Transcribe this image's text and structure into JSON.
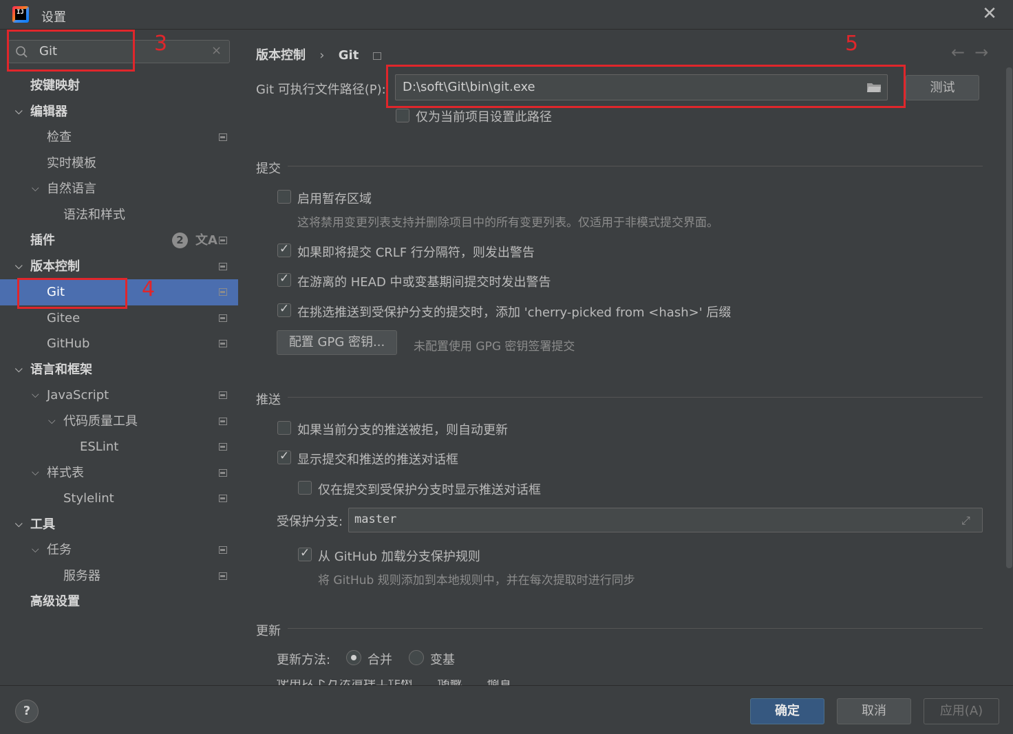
{
  "window": {
    "title": "设置",
    "close_icon": "close-icon"
  },
  "search": {
    "value": "Git",
    "clear": "×"
  },
  "sidebar": {
    "badge": "2",
    "items": [
      {
        "label": "按键映射"
      },
      {
        "label": "编辑器",
        "chevron": "v"
      },
      {
        "label": "检查"
      },
      {
        "label": "实时模板"
      },
      {
        "label": "自然语言",
        "chevron": "v"
      },
      {
        "label": "语法和样式"
      },
      {
        "label": "插件"
      },
      {
        "label": "版本控制",
        "chevron": "v"
      },
      {
        "label": "Git"
      },
      {
        "label": "Gitee"
      },
      {
        "label": "GitHub"
      },
      {
        "label": "语言和框架",
        "chevron": "v"
      },
      {
        "label": "JavaScript",
        "chevron": "v"
      },
      {
        "label": "代码质量工具",
        "chevron": "v"
      },
      {
        "label": "ESLint"
      },
      {
        "label": "样式表",
        "chevron": "v"
      },
      {
        "label": "Stylelint"
      },
      {
        "label": "工具",
        "chevron": "v"
      },
      {
        "label": "任务",
        "chevron": "v"
      },
      {
        "label": "服务器"
      },
      {
        "label": "高级设置"
      }
    ]
  },
  "breadcrumb": {
    "parent": "版本控制",
    "sep": "›",
    "current": "Git"
  },
  "nav_arrows": "←→",
  "git_path": {
    "label": "Git 可执行文件路径(P):",
    "value": "D:\\soft\\Git\\bin\\git.exe",
    "test_button": "测试",
    "project_only": "仅为当前项目设置此路径"
  },
  "commit": {
    "title": "提交",
    "staging": "启用暂存区域",
    "staging_hint": "这将禁用变更列表支持并删除项目中的所有变更列表。仅适用于非模式提交界面。",
    "crlf": "如果即将提交 CRLF 行分隔符，则发出警告",
    "detached": "在游离的 HEAD 中或变基期间提交时发出警告",
    "cherry": "在挑选推送到受保护分支的提交时，添加 'cherry-picked from <hash>' 后缀",
    "gpg_button": "配置 GPG 密钥...",
    "gpg_hint": "未配置使用 GPG 密钥签署提交"
  },
  "push": {
    "title": "推送",
    "auto_update": "如果当前分支的推送被拒，则自动更新",
    "show_dialog": "显示提交和推送的推送对话框",
    "protected_only": "仅在提交到受保护分支时显示推送对话框",
    "protected_label": "受保护分支:",
    "protected_value": "master",
    "github_rules": "从 GitHub 加载分支保护规则",
    "github_hint": "将 GitHub 规则添加到本地规则中，并在每次提取时进行同步"
  },
  "update": {
    "title": "更新",
    "method_label": "更新方法:",
    "merge": "合并",
    "rebase": "变基",
    "clean_label": "使用以下方法清理工作树",
    "stash": "储藏",
    "shelve": "搁置"
  },
  "footer": {
    "help": "?",
    "ok": "确定",
    "cancel": "取消",
    "apply": "应用(A)"
  },
  "annotations": {
    "n3": "3",
    "n4": "4",
    "n5": "5"
  },
  "colors": {
    "selection": "#4b6eaf",
    "annotation": "#e0262b",
    "ok_button": "#365880",
    "background": "#3c3f41"
  }
}
